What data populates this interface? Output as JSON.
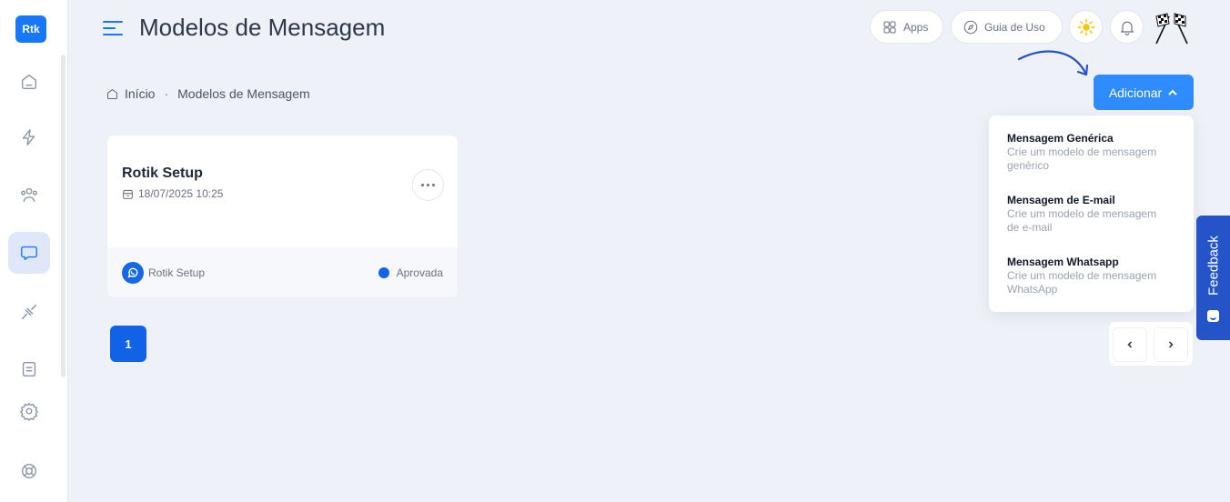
{
  "sidebar": {
    "logo": "Rtk",
    "items": [
      {
        "icon": "home-icon",
        "active": false
      },
      {
        "icon": "bolt-icon",
        "active": false
      },
      {
        "icon": "users-icon",
        "active": false
      },
      {
        "icon": "message-icon",
        "active": true
      },
      {
        "icon": "plug-icon",
        "active": false
      },
      {
        "icon": "document-icon",
        "active": false
      },
      {
        "icon": "settings-icon",
        "active": false
      },
      {
        "icon": "help-lifebuoy-icon",
        "active": false
      }
    ]
  },
  "header": {
    "title": "Modelos de Mensagem",
    "apps_label": "Apps",
    "guide_label": "Guia de Uso"
  },
  "breadcrumb": {
    "home": "Início",
    "separator": "·",
    "current": "Modelos de Mensagem"
  },
  "add_button": {
    "label": "Adicionar"
  },
  "dropdown": {
    "items": [
      {
        "title": "Mensagem Genérica",
        "line1": "Crie um modelo de mensagem",
        "line2": "genérico"
      },
      {
        "title": "Mensagem de E-mail",
        "line1": "Crie um modelo de mensagem",
        "line2": "de e-mail"
      },
      {
        "title": "Mensagem Whatsapp",
        "line1": "Crie um modelo de mensagem",
        "line2": "WhatsApp"
      }
    ]
  },
  "feedback": {
    "label": "Feedback"
  },
  "card": {
    "title": "Rotik Setup",
    "date": "18/07/2025 10:25",
    "channel_name": "Rotik Setup",
    "status": "Aprovada"
  },
  "pagination": {
    "current_page": "1"
  },
  "colors": {
    "primary": "#1677ff",
    "button": "#2f8cff",
    "feedback": "#2454c8",
    "status_dot": "#1262e8"
  }
}
